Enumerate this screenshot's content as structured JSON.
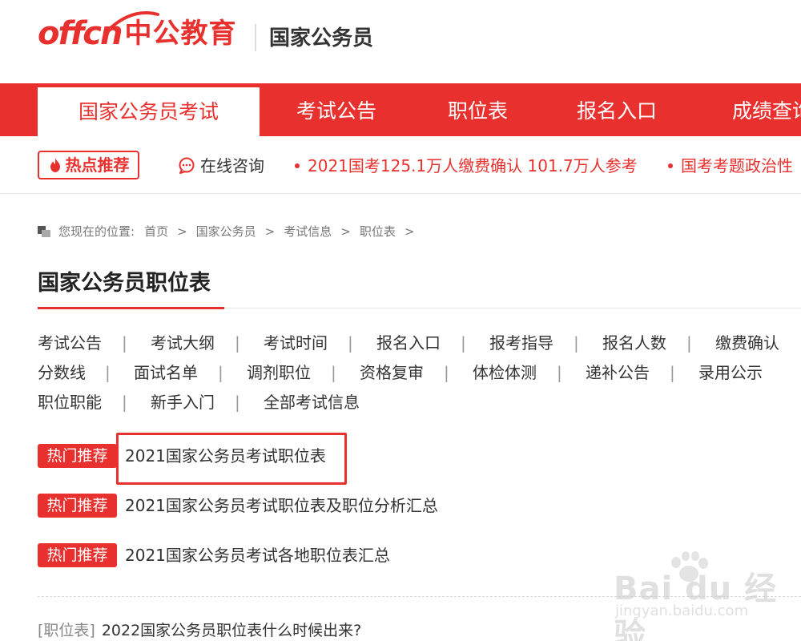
{
  "header": {
    "logo_latin": "offcn",
    "logo_cn": "中公教育",
    "section": "国家公务员"
  },
  "nav": {
    "items": [
      {
        "label": "国家公务员考试",
        "active": true
      },
      {
        "label": "考试公告"
      },
      {
        "label": "职位表"
      },
      {
        "label": "报名入口"
      },
      {
        "label": "成绩查询"
      }
    ]
  },
  "hotbar": {
    "tag": "热点推荐",
    "consult": "在线咨询",
    "news": [
      "2021国考125.1万人缴费确认 101.7万人参考",
      "国考考题政治性"
    ]
  },
  "breadcrumb": {
    "prefix": "您现在的位置:",
    "items": [
      "首页",
      "国家公务员",
      "考试信息",
      "职位表"
    ],
    "sep": ">"
  },
  "page_title": "国家公务员职位表",
  "categories": {
    "rows": [
      [
        "考试公告",
        "考试大纲",
        "考试时间",
        "报名入口",
        "报考指导",
        "报名人数",
        "缴费确认"
      ],
      [
        "分数线",
        "面试名单",
        "调剂职位",
        "资格复审",
        "体检体测",
        "递补公告",
        "录用公示"
      ],
      [
        "职位职能",
        "新手入门",
        "全部考试信息"
      ]
    ],
    "sep": "|"
  },
  "recommendations": {
    "tag": "热门推荐",
    "items": [
      "2021国家公务员考试职位表",
      "2021国家公务员考试职位表及职位分析汇总",
      "2021国家公务员考试各地职位表汇总"
    ]
  },
  "articles": [
    {
      "category": "[职位表]",
      "title": "2022国家公务员职位表什么时候出来?"
    }
  ],
  "watermark": {
    "main": "Bai du 经验",
    "sub": "jingyan.baidu.com"
  },
  "colors": {
    "brand_red": "#e8302e",
    "text": "#333333",
    "muted": "#777777"
  }
}
